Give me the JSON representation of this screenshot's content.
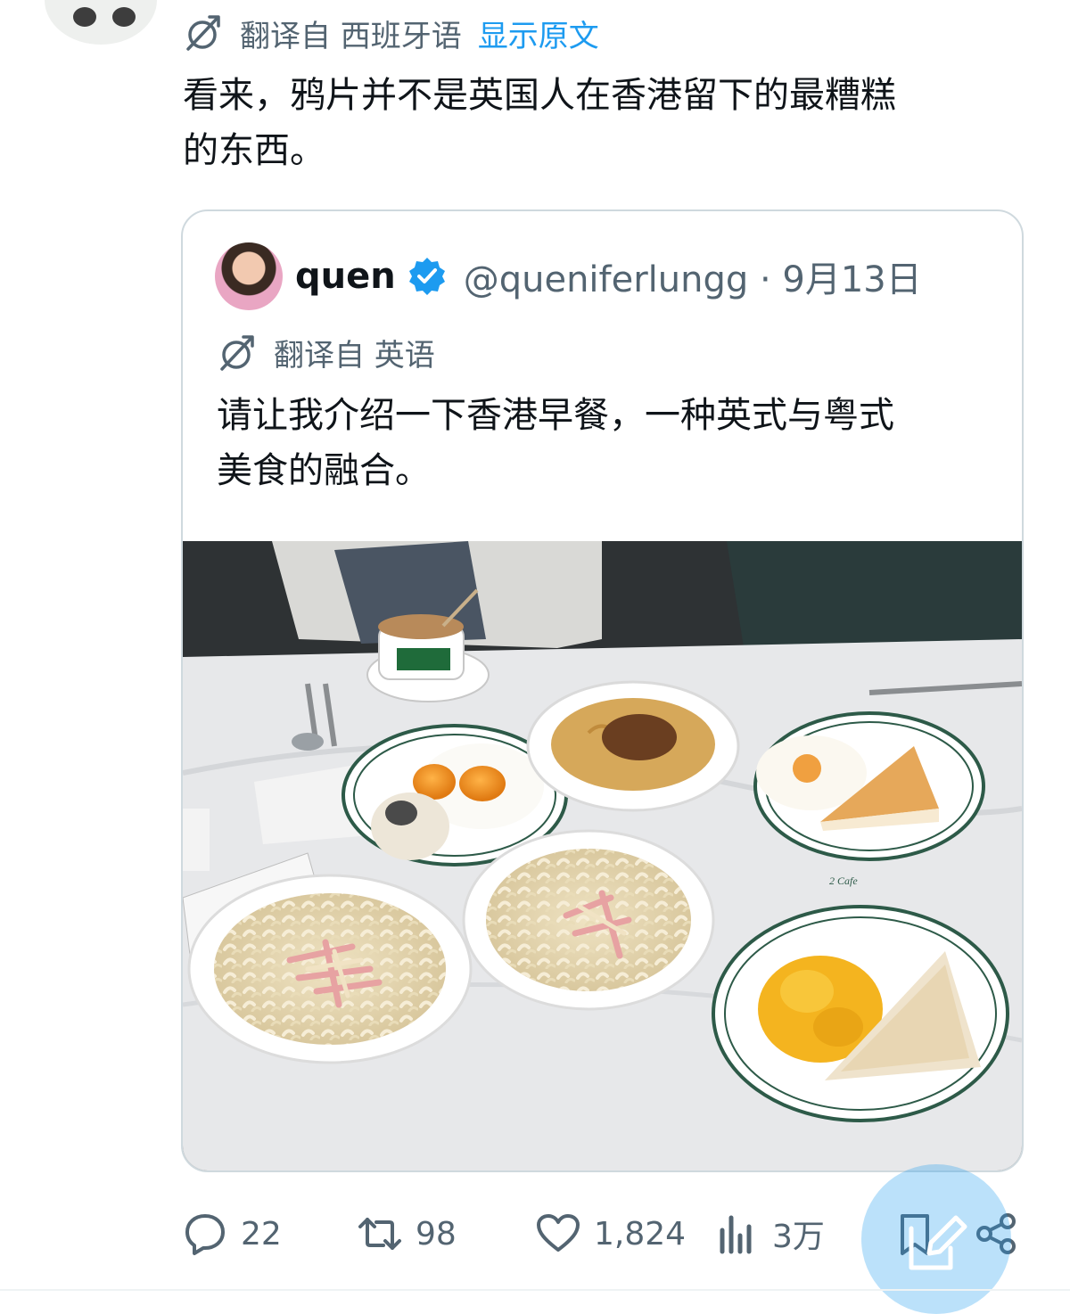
{
  "reply": {
    "translated_from_label": "翻译自 西班牙语",
    "show_original_label": "显示原文",
    "text_line1": "看来，鸦片并不是英国人在香港留下的最糟糕",
    "text_line2": "的东西。"
  },
  "quote": {
    "author_name": "quen",
    "verified": true,
    "handle_date": "@queniferlungg · 9月13日",
    "translated_from_label": "翻译自 英语",
    "text_line1": "请让我介绍一下香港早餐，一种英式与粤式",
    "text_line2": "美食的融合。",
    "photo_cafe_mark": "2 Cafe"
  },
  "actions": {
    "replies": "22",
    "reposts": "98",
    "likes": "1,824",
    "views": "3万"
  },
  "colors": {
    "accent": "#1d9bf0",
    "muted": "#536471",
    "border": "#cfd9de",
    "text": "#0f1419"
  },
  "icons": [
    "translate-icon",
    "verified-badge-icon",
    "reply-icon",
    "repost-icon",
    "like-icon",
    "views-icon",
    "bookmark-icon",
    "share-icon",
    "compose-icon"
  ]
}
